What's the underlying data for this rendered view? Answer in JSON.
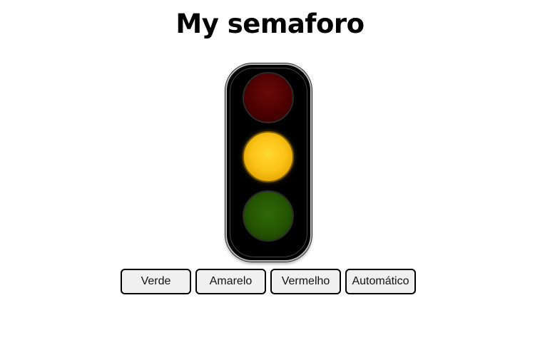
{
  "page": {
    "title": "My semaforo"
  },
  "traffic_light": {
    "active_lamp": "yellow",
    "lamps": [
      {
        "name": "red",
        "state": "off",
        "color": "#4c0000"
      },
      {
        "name": "yellow",
        "state": "on",
        "color": "#fcc419"
      },
      {
        "name": "green",
        "state": "off",
        "color": "#245400"
      }
    ]
  },
  "controls": {
    "verde_label": "Verde",
    "amarelo_label": "Amarelo",
    "vermelho_label": "Vermelho",
    "automatico_label": "Automático"
  }
}
